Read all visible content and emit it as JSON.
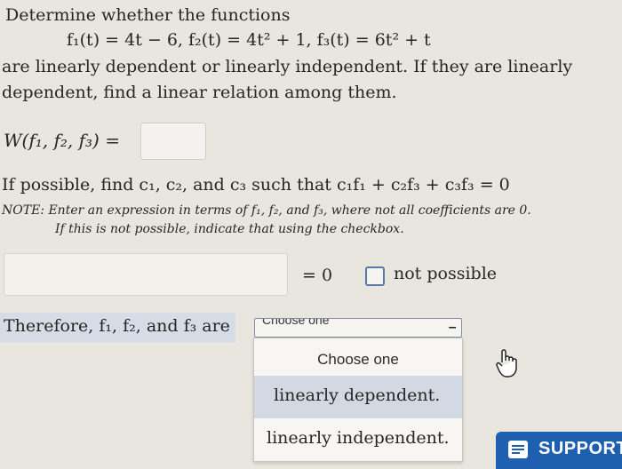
{
  "problem": {
    "intro": "Determine whether the functions",
    "functions": "f₁(t) = 4t − 6,   f₂(t) = 4t² + 1,   f₃(t) = 6t² + t",
    "line3": "are linearly dependent or linearly independent. If they are linearly",
    "line4": "dependent, find a linear relation among them."
  },
  "wronskian": {
    "label": "W(f₁, f₂, f₃) =",
    "value": ""
  },
  "coefficients": {
    "prompt": "If possible, find c₁, c₂, and c₃ such that c₁f₁ + c₂f₃ + c₃f₃ = 0",
    "note_line1": "NOTE: Enter an expression in terms of f₁, f₂, and f₃, where not all coefficients are 0.",
    "note_line2": "If this is not possible, indicate that using the checkbox.",
    "expression_value": "",
    "equals_zero": "= 0",
    "not_possible_label": "not possible",
    "not_possible_checked": false
  },
  "conclusion": {
    "label": "Therefore, f₁, f₂, and f₃ are",
    "select_value": "Choose one",
    "options_header": "Choose one",
    "options": [
      "linearly dependent.",
      "linearly independent."
    ],
    "highlighted_option": "linearly dependent."
  },
  "support": {
    "label": "SUPPORT",
    "icon": "chat-icon",
    "color": "#1f5fb0"
  }
}
